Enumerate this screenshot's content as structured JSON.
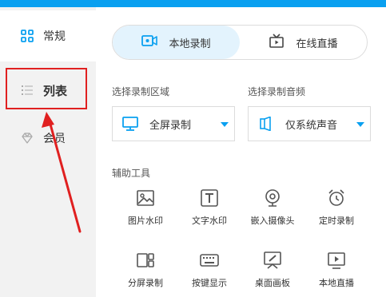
{
  "sidebar": {
    "items": [
      {
        "label": "常规",
        "icon": "grid-icon"
      },
      {
        "label": "列表",
        "icon": "list-icon"
      },
      {
        "label": "会员",
        "icon": "diamond-icon"
      }
    ]
  },
  "tabs": [
    {
      "label": "本地录制",
      "icon": "video-camera-icon",
      "active": true
    },
    {
      "label": "在线直播",
      "icon": "tv-icon",
      "active": false
    }
  ],
  "record_area": {
    "label": "选择录制区域",
    "value": "全屏录制",
    "icon": "monitor-icon"
  },
  "record_audio": {
    "label": "选择录制音频",
    "value": "仅系统声音",
    "icon": "speaker-icon"
  },
  "tools": {
    "label": "辅助工具",
    "items": [
      {
        "label": "图片水印",
        "icon": "image-icon"
      },
      {
        "label": "文字水印",
        "icon": "text-icon"
      },
      {
        "label": "嵌入摄像头",
        "icon": "webcam-icon"
      },
      {
        "label": "定时录制",
        "icon": "alarm-clock-icon"
      },
      {
        "label": "分屏录制",
        "icon": "split-screen-icon"
      },
      {
        "label": "按键显示",
        "icon": "keyboard-icon"
      },
      {
        "label": "桌面画板",
        "icon": "drawing-board-icon"
      },
      {
        "label": "本地直播",
        "icon": "local-live-icon"
      }
    ]
  },
  "colors": {
    "accent": "#0aa0f0",
    "annotation": "#e02020",
    "sidebar_bg": "#f2f2f2",
    "active_tab_bg": "#e3f3fd"
  }
}
